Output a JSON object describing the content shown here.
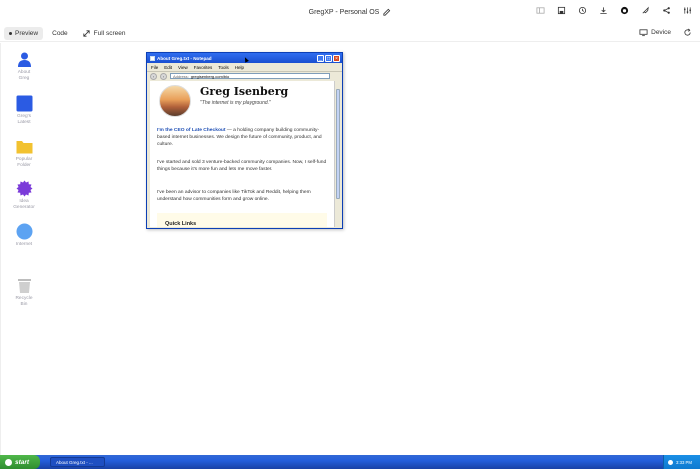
{
  "app": {
    "title": "GregXP - Personal OS"
  },
  "toolbar": {
    "preview_label": "Preview",
    "code_label": "Code",
    "fullscreen_label": "Full screen",
    "device_label": "Device"
  },
  "desktop": {
    "icons": [
      {
        "label_line1": "About",
        "label_line2": "Greg",
        "icon": "user-icon",
        "color": "#2b5be3"
      },
      {
        "label_line1": "Greg's",
        "label_line2": "Latest",
        "icon": "latest-icon",
        "color": "#2b5be3"
      },
      {
        "label_line1": "Popular",
        "label_line2": "Folder",
        "icon": "folder-icon",
        "color": "#f2c230"
      },
      {
        "label_line1": "Idea",
        "label_line2": "Generator",
        "icon": "idea-generator-icon",
        "color": "#7b3bd9"
      },
      {
        "label_line1": "Internet",
        "label_line2": "",
        "icon": "internet-icon",
        "color": "#5da3f2"
      },
      {
        "label_line1": "Recycle",
        "label_line2": "Bin",
        "icon": "recycle-bin-icon",
        "color": "#bdbdbd"
      }
    ]
  },
  "window": {
    "title": "About Greg.txt - Notepad",
    "menu": [
      "File",
      "Edit",
      "View",
      "Favorites",
      "Tools",
      "Help"
    ],
    "address_label": "Address:",
    "address_value": "gregisenberg.com/bio",
    "name": "Greg Isenberg",
    "tagline": "\"The internet is my playground.\"",
    "p1_highlight": "I'm the CEO of Late Checkout",
    "p1_rest": " — a holding company building community-based internet businesses. We design the future of community, product, and culture.",
    "p2": "I've started and sold 3 venture-backed community companies. Now, I self-fund things because it's more fun and lets me move faster.",
    "p3": "I've been an advisor to companies like TikTok and Reddit, helping them understand how communities form and grow online.",
    "quick_links": "Quick Links"
  },
  "taskbar": {
    "start_label": "start",
    "task_label": "About Greg.txt - ...",
    "clock": "3:33 PM"
  }
}
